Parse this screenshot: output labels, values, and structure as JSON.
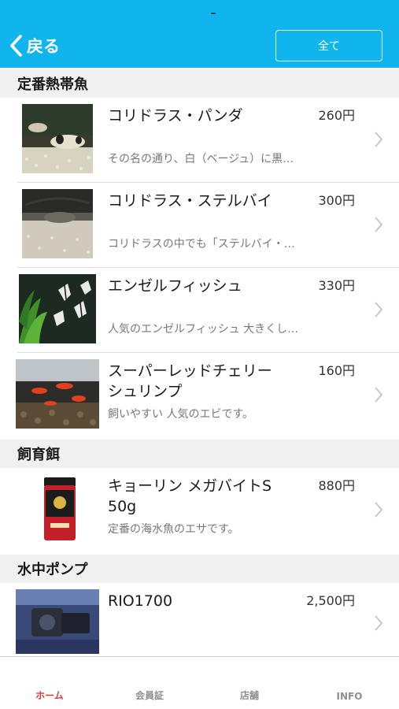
{
  "nav": {
    "back_label": "戻る",
    "all_button_label": "全て",
    "bar_color": "#10b5ee"
  },
  "sections": [
    {
      "title": "定番熱帯魚",
      "items": [
        {
          "name": "コリドラス・パンダ",
          "price": "260円",
          "description": "その名の通り、白（ベージュ）に黒…",
          "thumb": "corydoras-panda-photo"
        },
        {
          "name": "コリドラス・ステルバイ",
          "price": "300円",
          "description": "コリドラスの中でも「ステルバイ・…",
          "thumb": "corydoras-sterbai-photo"
        },
        {
          "name": "エンゼルフィッシュ",
          "price": "330円",
          "description": "人気のエンゼルフィッシュ 大きくし…",
          "thumb": "angelfish-photo"
        },
        {
          "name": "スーパーレッドチェリーシュリンプ",
          "price": "160円",
          "description": "飼いやすい 人気のエビです。",
          "thumb": "red-cherry-shrimp-photo"
        }
      ]
    },
    {
      "title": "飼育餌",
      "items": [
        {
          "name": "キョーリン メガバイトS 50g",
          "price": "880円",
          "description": "定番の海水魚のエサです。",
          "thumb": "food-container-photo"
        }
      ]
    },
    {
      "title": "水中ポンプ",
      "items": [
        {
          "name": "RIO1700",
          "price": "2,500円",
          "description": "",
          "thumb": "water-pump-photo"
        }
      ]
    }
  ],
  "tabs": [
    {
      "label": "ホーム",
      "active": true
    },
    {
      "label": "会員証",
      "active": false
    },
    {
      "label": "店舗",
      "active": false
    },
    {
      "label": "INFO",
      "active": false
    }
  ],
  "colors": {
    "active_tab": "#e53935",
    "inactive_tab": "#8e8e8e"
  }
}
